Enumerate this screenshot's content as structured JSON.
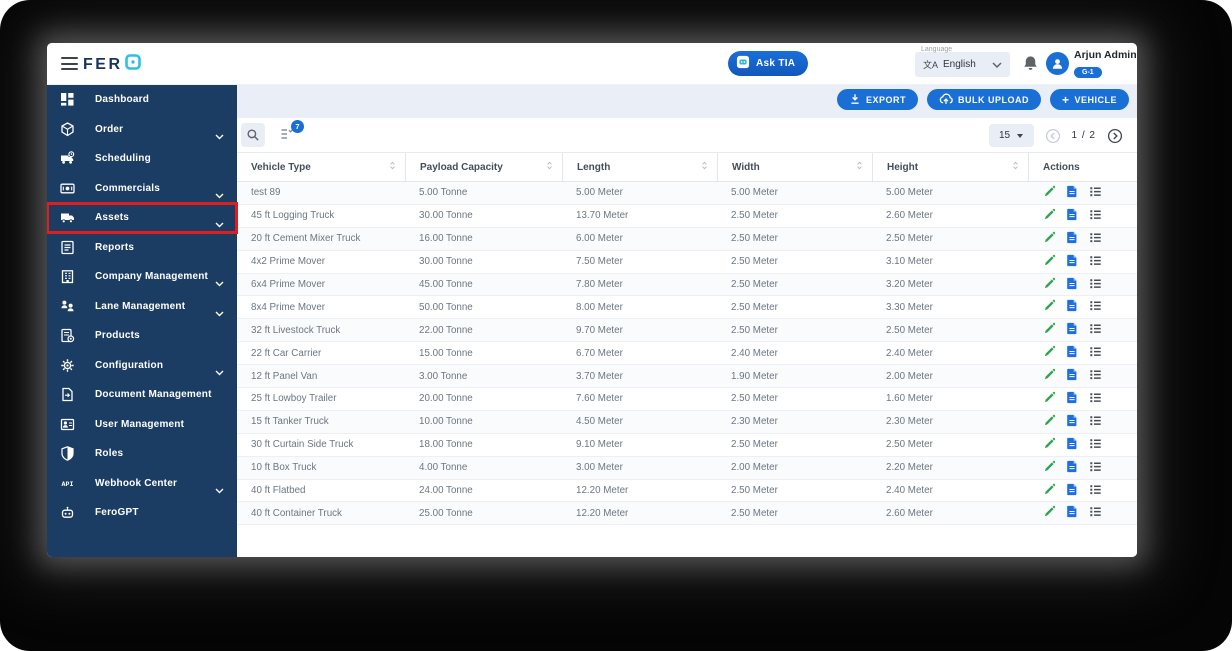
{
  "colors": {
    "sidebar_bg": "#1b3c63",
    "accent_blue": "#1a6fd4",
    "annotation_red": "#e01e1e",
    "edit_green": "#2ea44f",
    "doc_blue": "#1d6fe0",
    "content_bg": "#e9eef7"
  },
  "header": {
    "logo_text": "FER",
    "ask_tia_label": "Ask TIA",
    "language_label": "Language",
    "language_glyph": "文A",
    "language_value": "English",
    "user_name": "Arjun Admin",
    "user_badge": "G-1"
  },
  "sidebar": {
    "items": [
      {
        "label": "Dashboard",
        "icon": "dashboard-icon",
        "expandable": false,
        "highlighted": false
      },
      {
        "label": "Order",
        "icon": "order-icon",
        "expandable": true,
        "highlighted": false
      },
      {
        "label": "Scheduling",
        "icon": "scheduling-icon",
        "expandable": false,
        "highlighted": false
      },
      {
        "label": "Commercials",
        "icon": "commercials-icon",
        "expandable": true,
        "highlighted": false
      },
      {
        "label": "Assets",
        "icon": "assets-truck-icon",
        "expandable": true,
        "highlighted": true
      },
      {
        "label": "Reports",
        "icon": "reports-icon",
        "expandable": false,
        "highlighted": false
      },
      {
        "label": "Company Management",
        "icon": "company-management-icon",
        "expandable": true,
        "highlighted": false
      },
      {
        "label": "Lane Management",
        "icon": "lane-management-icon",
        "expandable": true,
        "highlighted": false
      },
      {
        "label": "Products",
        "icon": "products-icon",
        "expandable": false,
        "highlighted": false
      },
      {
        "label": "Configuration",
        "icon": "configuration-gear-icon",
        "expandable": true,
        "highlighted": false
      },
      {
        "label": "Document Management",
        "icon": "document-management-icon",
        "expandable": false,
        "highlighted": false
      },
      {
        "label": "User Management",
        "icon": "user-management-icon",
        "expandable": false,
        "highlighted": false
      },
      {
        "label": "Roles",
        "icon": "shield-icon",
        "expandable": false,
        "highlighted": false
      },
      {
        "label": "Webhook Center",
        "icon": "api-icon",
        "expandable": true,
        "highlighted": false
      },
      {
        "label": "FeroGPT",
        "icon": "robot-icon",
        "expandable": false,
        "highlighted": false
      }
    ]
  },
  "toolbar": {
    "export_label": "EXPORT",
    "bulk_upload_label": "BULK UPLOAD",
    "add_vehicle_label": "VEHICLE",
    "add_vehicle_plus": "+",
    "filter_badge_count": "7",
    "page_size": "15",
    "page_indicator": "1 / 2"
  },
  "table": {
    "columns": [
      "Vehicle Type",
      "Payload Capacity",
      "Length",
      "Width",
      "Height",
      "Actions"
    ],
    "rows": [
      {
        "vehicle_type": "test 89",
        "payload": "5.00 Tonne",
        "length": "5.00 Meter",
        "width": "5.00 Meter",
        "height": "5.00 Meter"
      },
      {
        "vehicle_type": "45 ft Logging Truck",
        "payload": "30.00 Tonne",
        "length": "13.70 Meter",
        "width": "2.50 Meter",
        "height": "2.60 Meter"
      },
      {
        "vehicle_type": "20 ft Cement Mixer Truck",
        "payload": "16.00 Tonne",
        "length": "6.00 Meter",
        "width": "2.50 Meter",
        "height": "2.50 Meter"
      },
      {
        "vehicle_type": "4x2 Prime Mover",
        "payload": "30.00 Tonne",
        "length": "7.50 Meter",
        "width": "2.50 Meter",
        "height": "3.10 Meter"
      },
      {
        "vehicle_type": "6x4 Prime Mover",
        "payload": "45.00 Tonne",
        "length": "7.80 Meter",
        "width": "2.50 Meter",
        "height": "3.20 Meter"
      },
      {
        "vehicle_type": "8x4 Prime Mover",
        "payload": "50.00 Tonne",
        "length": "8.00 Meter",
        "width": "2.50 Meter",
        "height": "3.30 Meter"
      },
      {
        "vehicle_type": "32 ft Livestock Truck",
        "payload": "22.00 Tonne",
        "length": "9.70 Meter",
        "width": "2.50 Meter",
        "height": "2.50 Meter"
      },
      {
        "vehicle_type": "22 ft Car Carrier",
        "payload": "15.00 Tonne",
        "length": "6.70 Meter",
        "width": "2.40 Meter",
        "height": "2.40 Meter"
      },
      {
        "vehicle_type": "12 ft Panel Van",
        "payload": "3.00 Tonne",
        "length": "3.70 Meter",
        "width": "1.90 Meter",
        "height": "2.00 Meter"
      },
      {
        "vehicle_type": "25 ft Lowboy Trailer",
        "payload": "20.00 Tonne",
        "length": "7.60 Meter",
        "width": "2.50 Meter",
        "height": "1.60 Meter"
      },
      {
        "vehicle_type": "15 ft Tanker Truck",
        "payload": "10.00 Tonne",
        "length": "4.50 Meter",
        "width": "2.30 Meter",
        "height": "2.30 Meter"
      },
      {
        "vehicle_type": "30 ft Curtain Side Truck",
        "payload": "18.00 Tonne",
        "length": "9.10 Meter",
        "width": "2.50 Meter",
        "height": "2.50 Meter"
      },
      {
        "vehicle_type": "10 ft Box Truck",
        "payload": "4.00 Tonne",
        "length": "3.00 Meter",
        "width": "2.00 Meter",
        "height": "2.20 Meter"
      },
      {
        "vehicle_type": "40 ft Flatbed",
        "payload": "24.00 Tonne",
        "length": "12.20 Meter",
        "width": "2.50 Meter",
        "height": "2.40 Meter"
      },
      {
        "vehicle_type": "40 ft Container Truck",
        "payload": "25.00 Tonne",
        "length": "12.20 Meter",
        "width": "2.50 Meter",
        "height": "2.60 Meter"
      }
    ]
  }
}
